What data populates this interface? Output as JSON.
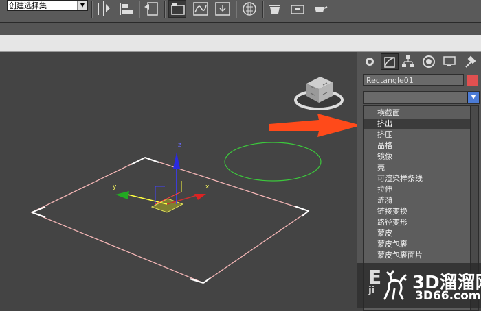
{
  "toolbar": {
    "selection_set_placeholder": "创建选择集"
  },
  "command_panel": {
    "object_name": "Rectangle01",
    "object_color": "#e05050",
    "tabs": [
      "create-icon",
      "modify-icon",
      "hierarchy-icon",
      "motion-icon",
      "display-icon",
      "utilities-icon"
    ],
    "modifier_list": {
      "items": [
        "横截面",
        "挤出",
        "挤压",
        "晶格",
        "镜像",
        "壳",
        "可渲染样条线",
        "拉伸",
        "涟漪",
        "链接变换",
        "路径变形",
        "蒙皮",
        "蒙皮包裹",
        "蒙皮包裹面片"
      ],
      "highlighted": "挤出"
    }
  },
  "viewport": {
    "gizmo_axes": [
      "x",
      "y",
      "z"
    ]
  },
  "watermark": {
    "brand": "3D溜溜网",
    "site": "3D66.com",
    "partial_text_1": "E",
    "partial_text_2": "ji"
  },
  "colors": {
    "accent": "#4b7bd6",
    "arrow": "#ff4a1a",
    "selection_outline": "#e8b0b0",
    "spline_green": "#3cc83c"
  }
}
